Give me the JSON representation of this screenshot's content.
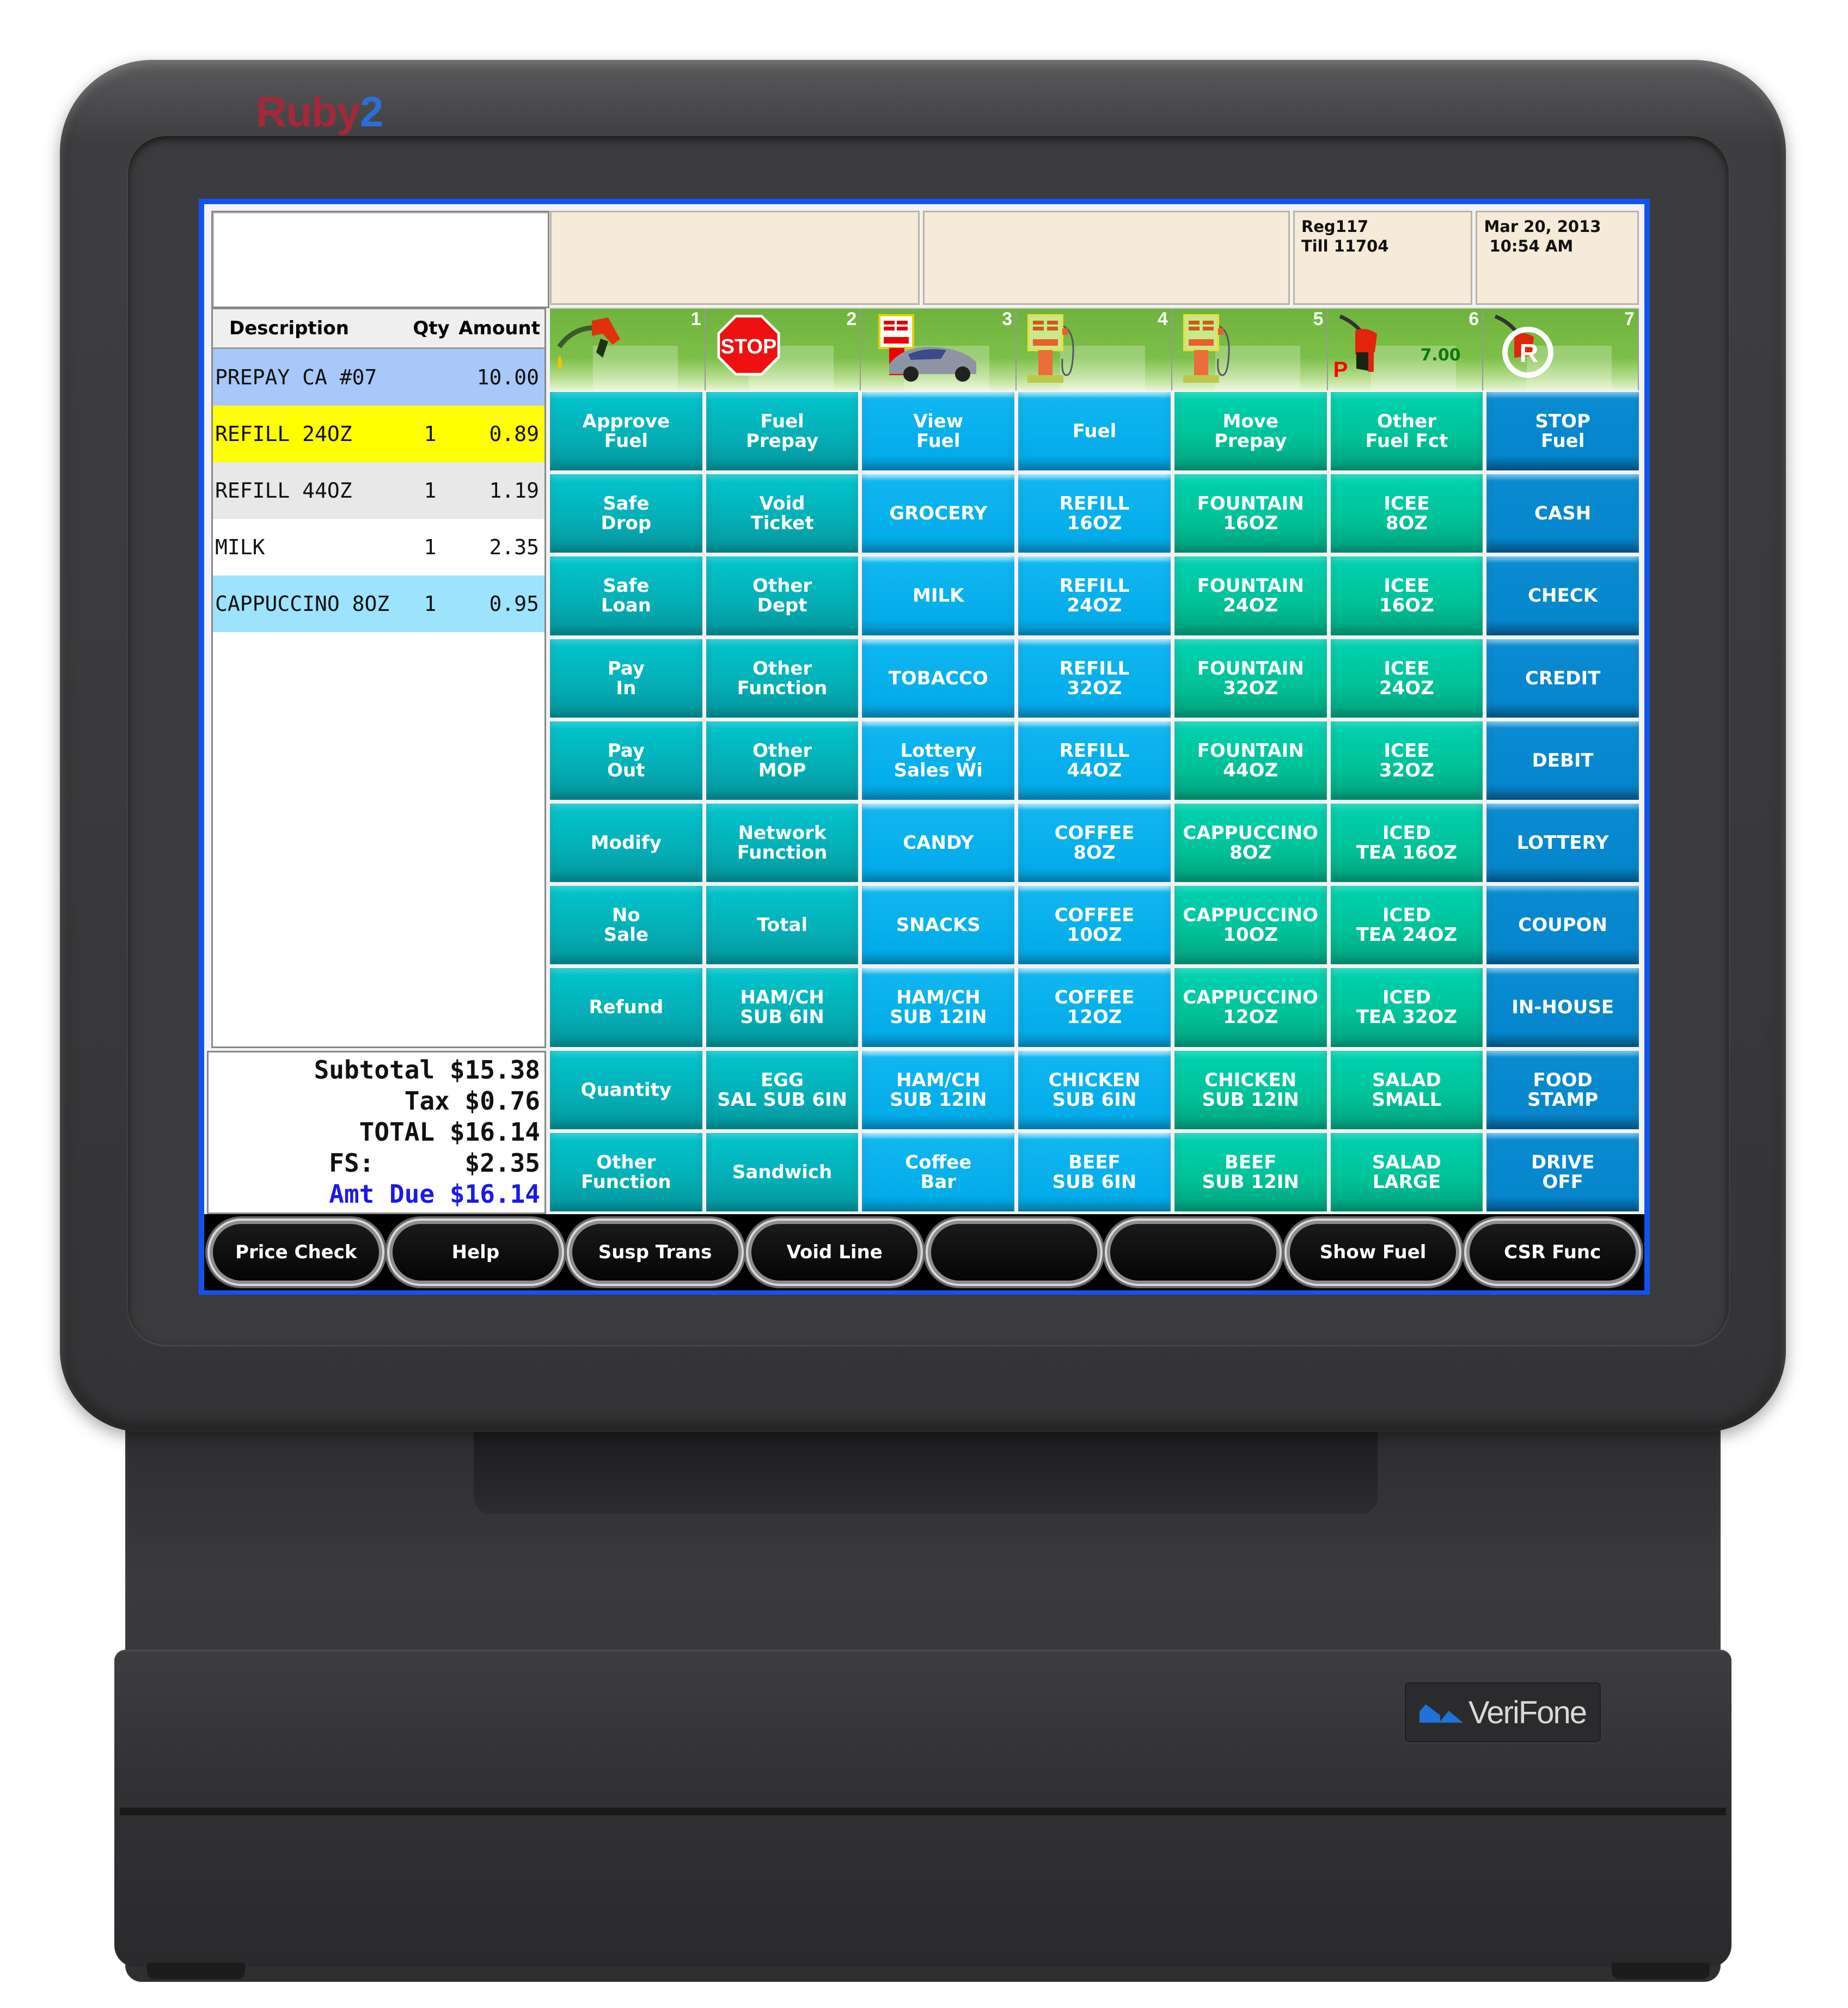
{
  "device": {
    "model_logo": {
      "part1": "Ruby",
      "part2": "2"
    },
    "brand": "VeriFone"
  },
  "header": {
    "message_box": "",
    "info_cells": [
      {
        "lines": [
          ""
        ]
      },
      {
        "lines": [
          ""
        ]
      },
      {
        "lines": [
          "Reg117",
          "Till 11704"
        ]
      },
      {
        "lines": [
          "Mar 20, 2013",
          " 10:54 AM"
        ]
      }
    ]
  },
  "receipt": {
    "columns": {
      "description": "Description",
      "qty": "Qty",
      "amount": "Amount"
    },
    "rows": [
      {
        "description": "PREPAY CA #07",
        "qty": "",
        "amount": "10.00",
        "bg": "#a8c8fa"
      },
      {
        "description": "REFILL 24OZ",
        "qty": "1",
        "amount": "0.89",
        "bg": "#ffff00"
      },
      {
        "description": "REFILL 44OZ",
        "qty": "1",
        "amount": "1.19",
        "bg": "#e8e8e8"
      },
      {
        "description": "MILK",
        "qty": "1",
        "amount": "2.35",
        "bg": "#ffffff"
      },
      {
        "description": "CAPPUCCINO 8OZ",
        "qty": "1",
        "amount": "0.95",
        "bg": "#9de3fb"
      }
    ]
  },
  "totals": {
    "subtotal": "Subtotal $15.38",
    "tax": "Tax $0.76",
    "total": "TOTAL $16.14",
    "fs": "FS:      $2.35",
    "amt_due": "Amt Due $16.14"
  },
  "fuel_pumps": [
    {
      "number": "1",
      "icon": "fuel-nozzle-dispensing-icon",
      "amount": "",
      "flag": ""
    },
    {
      "number": "2",
      "icon": "stop-sign-icon",
      "amount": "",
      "flag": ""
    },
    {
      "number": "3",
      "icon": "pump-with-car-icon",
      "amount": "",
      "flag": ""
    },
    {
      "number": "4",
      "icon": "gas-pump-idle-icon",
      "amount": "",
      "flag": ""
    },
    {
      "number": "5",
      "icon": "gas-pump-idle-icon",
      "amount": "",
      "flag": ""
    },
    {
      "number": "6",
      "icon": "fuel-nozzle-prepay-icon",
      "amount": "7.00",
      "flag": "P"
    },
    {
      "number": "7",
      "icon": "fuel-nozzle-reserved-icon",
      "amount": "",
      "flag": ""
    }
  ],
  "keypad": {
    "rows": [
      [
        "Approve\nFuel",
        "Fuel\nPrepay",
        "View\nFuel",
        "Fuel",
        "Move\nPrepay",
        "Other\nFuel Fct",
        "STOP\nFuel"
      ],
      [
        "Safe\nDrop",
        "Void\nTicket",
        "GROCERY",
        "REFILL\n16OZ",
        "FOUNTAIN\n16OZ",
        "ICEE\n8OZ",
        "CASH"
      ],
      [
        "Safe\nLoan",
        "Other\nDept",
        "MILK",
        "REFILL\n24OZ",
        "FOUNTAIN\n24OZ",
        "ICEE\n16OZ",
        "CHECK"
      ],
      [
        "Pay\nIn",
        "Other\nFunction",
        "TOBACCO",
        "REFILL\n32OZ",
        "FOUNTAIN\n32OZ",
        "ICEE\n24OZ",
        "CREDIT"
      ],
      [
        "Pay\nOut",
        "Other\nMOP",
        "Lottery\nSales Wi",
        "REFILL\n44OZ",
        "FOUNTAIN\n44OZ",
        "ICEE\n32OZ",
        "DEBIT"
      ],
      [
        "Modify",
        "Network\nFunction",
        "CANDY",
        "COFFEE\n8OZ",
        "CAPPUCCINO\n8OZ",
        "ICED\nTEA 16OZ",
        "LOTTERY"
      ],
      [
        "No\nSale",
        "Total",
        "SNACKS",
        "COFFEE\n10OZ",
        "CAPPUCCINO\n10OZ",
        "ICED\nTEA 24OZ",
        "COUPON"
      ],
      [
        "Refund",
        "HAM/CH\nSUB 6IN",
        "HAM/CH\nSUB 12IN",
        "COFFEE\n12OZ",
        "CAPPUCCINO\n12OZ",
        "ICED\nTEA 32OZ",
        "IN-HOUSE"
      ],
      [
        "Quantity",
        "EGG\nSAL SUB 6IN",
        "HAM/CH\nSUB 12IN",
        "CHICKEN\nSUB 6IN",
        "CHICKEN\nSUB 12IN",
        "SALAD\nSMALL",
        "FOOD\nSTAMP"
      ],
      [
        "Other\nFunction",
        "Sandwich",
        "Coffee\nBar",
        "BEEF\nSUB 6IN",
        "BEEF\nSUB 12IN",
        "SALAD\nLARGE",
        "DRIVE\nOFF"
      ]
    ],
    "column_colors": [
      "teal",
      "teal",
      "sky",
      "sky",
      "green",
      "green",
      "blue"
    ],
    "colors": {
      "teal": "#04aeb5",
      "sky": "#03acea",
      "green": "#00c196",
      "blue": "#0686cc"
    }
  },
  "softkeys": [
    "Price Check",
    "Help",
    "Susp Trans",
    "Void Line",
    "",
    "",
    "Show Fuel",
    "CSR Func"
  ]
}
